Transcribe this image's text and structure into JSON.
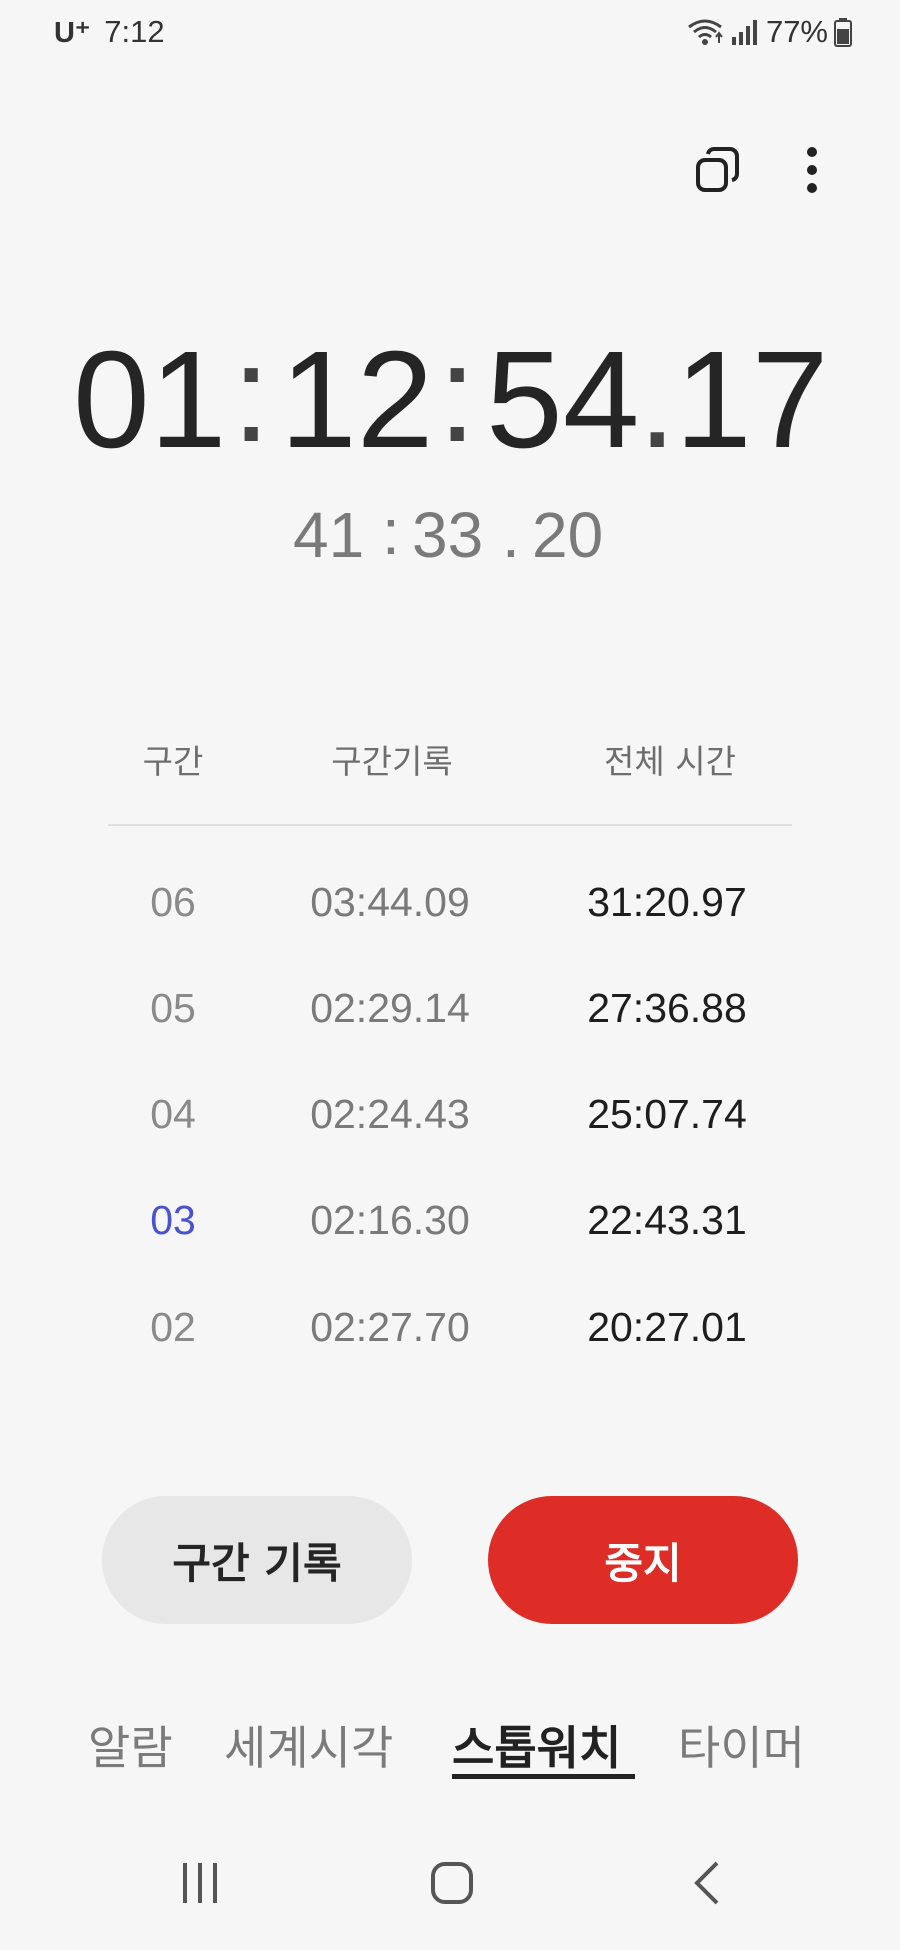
{
  "status_bar": {
    "carrier": "U⁺",
    "time": "7:12",
    "battery_percent": "77%",
    "wifi_icon": "wifi-icon",
    "signal_icon": "cellular-signal-icon",
    "battery_icon": "battery-icon",
    "battery_level": 0.77
  },
  "toolbar": {
    "copy_icon": "copy-icon",
    "more_icon": "more-vertical-icon"
  },
  "stopwatch": {
    "main": {
      "hours": "01",
      "sep1": ":",
      "minutes": "12",
      "sep2": ":",
      "seconds": "54",
      "sep3": ".",
      "hundredths": "17"
    },
    "lap": {
      "minutes": "41",
      "sep1": ":",
      "seconds": "33",
      "sep2": ".",
      "hundredths": "20"
    }
  },
  "laps": {
    "headers": {
      "lap": "구간",
      "split": "구간기록",
      "total": "전체 시간"
    },
    "rows": [
      {
        "num": "06",
        "split": "03:44.09",
        "total": "31:20.97"
      },
      {
        "num": "05",
        "split": "02:29.14",
        "total": "27:36.88"
      },
      {
        "num": "04",
        "split": "02:24.43",
        "total": "25:07.74"
      },
      {
        "num": "03",
        "split": "02:16.30",
        "total": "22:43.31"
      },
      {
        "num": "02",
        "split": "02:27.70",
        "total": "20:27.01"
      }
    ],
    "highlight_color": "#4b52cf"
  },
  "buttons": {
    "lap_label": "구간 기록",
    "stop_label": "중지",
    "stop_color": "#dd2d26"
  },
  "tabs": {
    "alarm": "알람",
    "world_clock": "세계시각",
    "stopwatch": "스톱워치",
    "timer": "타이머",
    "active": "stopwatch"
  },
  "navbar": {
    "recents_icon": "recent-apps-icon",
    "home_icon": "home-icon",
    "back_icon": "back-icon"
  }
}
